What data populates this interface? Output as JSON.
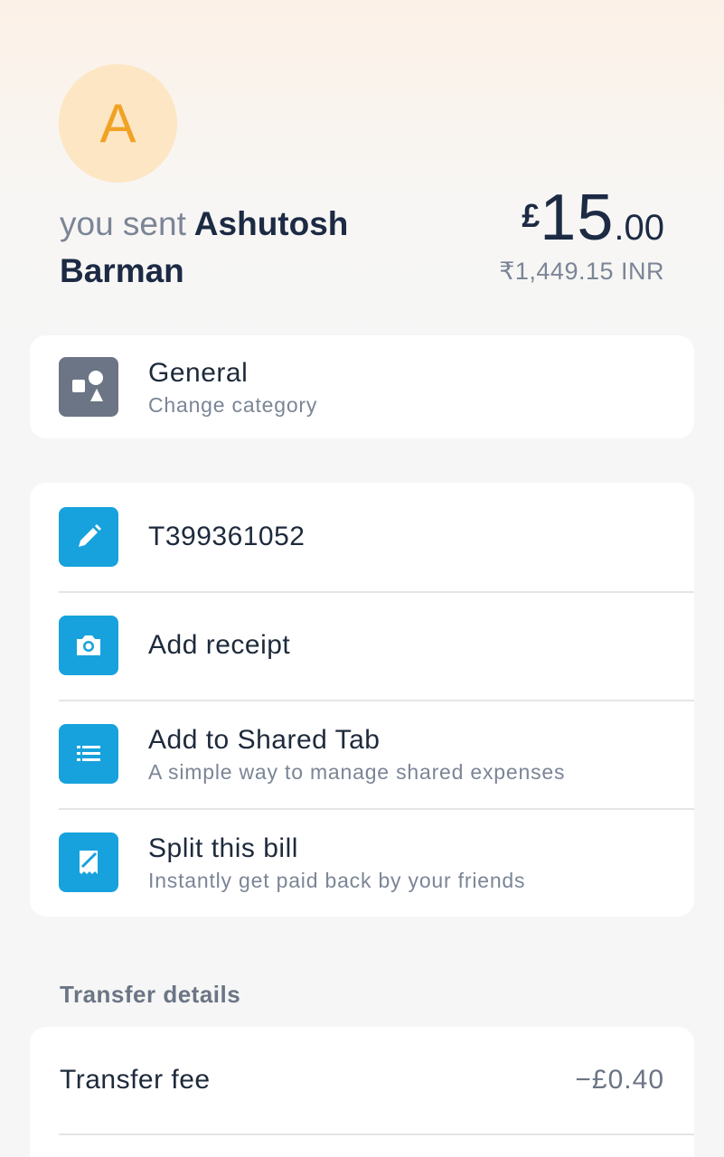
{
  "recipient": {
    "avatar_initial": "A",
    "prefix": "you sent",
    "name": "Ashutosh Barman"
  },
  "amount": {
    "currency_symbol": "£",
    "integer": "15",
    "decimal": ".00",
    "converted": "₹1,449.15 INR"
  },
  "category": {
    "title": "General",
    "subtitle": "Change category",
    "icon": "shapes-icon"
  },
  "actions": [
    {
      "title": "T399361052",
      "subtitle": "",
      "icon": "pencil-icon"
    },
    {
      "title": "Add receipt",
      "subtitle": "",
      "icon": "camera-icon"
    },
    {
      "title": "Add to Shared Tab",
      "subtitle": "A simple way to manage shared expenses",
      "icon": "list-icon"
    },
    {
      "title": "Split this bill",
      "subtitle": "Instantly get paid back by your friends",
      "icon": "receipt-icon"
    }
  ],
  "transfer_details": {
    "section_label": "Transfer details",
    "fee_label": "Transfer fee",
    "fee_value": "−£0.40"
  },
  "colors": {
    "accent_blue": "#17a2dd",
    "avatar_bg": "#fde6c4",
    "avatar_text": "#f0a224",
    "category_icon_bg": "#6c7585"
  }
}
